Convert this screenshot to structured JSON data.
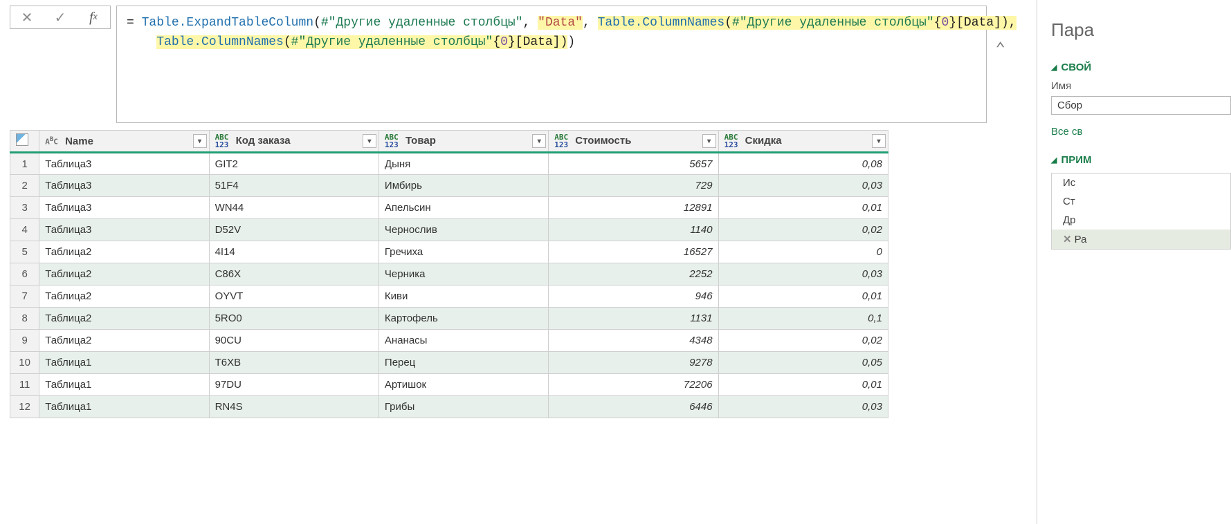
{
  "formula": {
    "prefix": "= ",
    "fn1": "Table.ExpandTableColumn",
    "open1": "(",
    "var1": "#\"Другие удаленные столбцы\"",
    "comma1": ", ",
    "str1": "\"Data\"",
    "comma2": ", ",
    "fn2": "Table.ColumnNames",
    "open2": "(",
    "var2": "#\"Другие удаленные столбцы\"",
    "brace1": "{",
    "num1": "0",
    "brace2": "}",
    "idx1": "[Data]",
    "close2": "),",
    "indent2": "    ",
    "fn3": "Table.ColumnNames",
    "open3": "(",
    "var3": "#\"Другие удаленные столбцы\"",
    "brace3": "{",
    "num2": "0",
    "brace4": "}",
    "idx2": "[Data]",
    "close3": ")",
    "close1": ")"
  },
  "columns": {
    "name": "Name",
    "code": "Код заказа",
    "product": "Товар",
    "cost": "Стоимость",
    "discount": "Скидка"
  },
  "rows": [
    {
      "n": "1",
      "name": "Таблица3",
      "code": "GIT2",
      "product": "Дыня",
      "cost": "5657",
      "discount": "0,08"
    },
    {
      "n": "2",
      "name": "Таблица3",
      "code": "51F4",
      "product": "Имбирь",
      "cost": "729",
      "discount": "0,03"
    },
    {
      "n": "3",
      "name": "Таблица3",
      "code": "WN44",
      "product": "Апельсин",
      "cost": "12891",
      "discount": "0,01"
    },
    {
      "n": "4",
      "name": "Таблица3",
      "code": "D52V",
      "product": "Чернослив",
      "cost": "1140",
      "discount": "0,02"
    },
    {
      "n": "5",
      "name": "Таблица2",
      "code": "4I14",
      "product": "Гречиха",
      "cost": "16527",
      "discount": "0"
    },
    {
      "n": "6",
      "name": "Таблица2",
      "code": "C86X",
      "product": "Черника",
      "cost": "2252",
      "discount": "0,03"
    },
    {
      "n": "7",
      "name": "Таблица2",
      "code": "OYVT",
      "product": "Киви",
      "cost": "946",
      "discount": "0,01"
    },
    {
      "n": "8",
      "name": "Таблица2",
      "code": "5RO0",
      "product": "Картофель",
      "cost": "1131",
      "discount": "0,1"
    },
    {
      "n": "9",
      "name": "Таблица2",
      "code": "90CU",
      "product": "Ананасы",
      "cost": "4348",
      "discount": "0,02"
    },
    {
      "n": "10",
      "name": "Таблица1",
      "code": "T6XB",
      "product": "Перец",
      "cost": "9278",
      "discount": "0,05"
    },
    {
      "n": "11",
      "name": "Таблица1",
      "code": "97DU",
      "product": "Артишок",
      "cost": "72206",
      "discount": "0,01"
    },
    {
      "n": "12",
      "name": "Таблица1",
      "code": "RN4S",
      "product": "Грибы",
      "cost": "6446",
      "discount": "0,03"
    }
  ],
  "rightPanel": {
    "title": "Пара",
    "propsHead": "СВОЙ",
    "nameLabel": "Имя",
    "nameValue": "Сбор",
    "allPropsLink": "Все св",
    "stepsHead": "ПРИМ",
    "steps": [
      "Ис",
      "Ст",
      "Др",
      "Ра"
    ],
    "activeStep": 3
  }
}
